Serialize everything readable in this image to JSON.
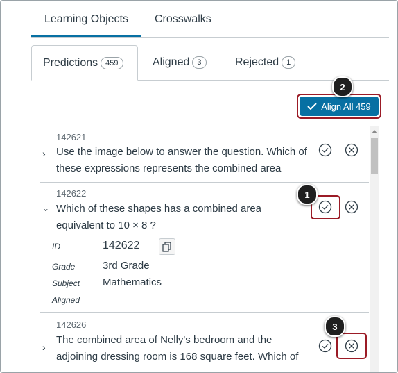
{
  "top_tabs": [
    "Learning Objects",
    "Crosswalks"
  ],
  "sub_tabs": [
    {
      "label": "Predictions",
      "count": "459"
    },
    {
      "label": "Aligned",
      "count": "3"
    },
    {
      "label": "Rejected",
      "count": "1"
    }
  ],
  "align_all_label": "Align All 459",
  "callouts": [
    "1",
    "2",
    "3"
  ],
  "items": [
    {
      "id": "142621",
      "text": "Use the image below to answer the question. Which of these expressions represents the combined area"
    },
    {
      "id": "142622",
      "text": "Which of these shapes has a combined area equivalent to 10 × 8 ?"
    },
    {
      "id": "142626",
      "text": "The combined area of Nelly's bedroom and the adjoining dressing room is 168 square feet. Which of"
    }
  ],
  "details": {
    "id_label": "ID",
    "id_value": "142622",
    "grade_label": "Grade",
    "grade_value": "3rd Grade",
    "subject_label": "Subject",
    "subject_value": "Mathematics",
    "aligned_label": "Aligned"
  },
  "colors": {
    "accent": "#0770a3",
    "highlight": "#9b1b26"
  }
}
